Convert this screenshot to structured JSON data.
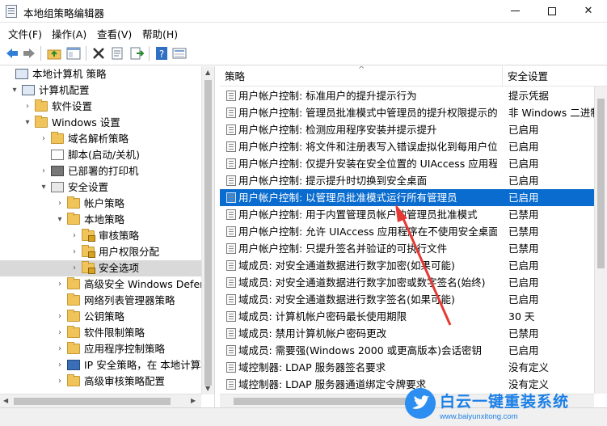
{
  "window": {
    "title": "本地组策略编辑器"
  },
  "menu": [
    {
      "label": "文件(F)"
    },
    {
      "label": "操作(A)"
    },
    {
      "label": "查看(V)"
    },
    {
      "label": "帮助(H)"
    }
  ],
  "toolbar_icons": [
    "back-arrow-icon",
    "forward-arrow-icon",
    "folder-up-icon",
    "show-tree-icon",
    "delete-icon",
    "properties-icon",
    "export-icon",
    "help-icon",
    "console-view-icon"
  ],
  "tree": [
    {
      "label": "本地计算机 策略",
      "level": 0,
      "toggle": "",
      "icon": "computer-icon"
    },
    {
      "label": "计算机配置",
      "level": 1,
      "toggle": "▾",
      "icon": "computer-icon"
    },
    {
      "label": "软件设置",
      "level": 2,
      "toggle": "›",
      "icon": "folder-icon"
    },
    {
      "label": "Windows 设置",
      "level": 2,
      "toggle": "▾",
      "icon": "folder-icon"
    },
    {
      "label": "域名解析策略",
      "level": 3,
      "toggle": "›",
      "icon": "folder-icon"
    },
    {
      "label": "脚本(启动/关机)",
      "level": 3,
      "toggle": "",
      "icon": "script-icon"
    },
    {
      "label": "已部署的打印机",
      "level": 3,
      "toggle": "›",
      "icon": "printer-icon"
    },
    {
      "label": "安全设置",
      "level": 3,
      "toggle": "▾",
      "icon": "security-icon"
    },
    {
      "label": "帐户策略",
      "level": 4,
      "toggle": "›",
      "icon": "folder-icon"
    },
    {
      "label": "本地策略",
      "level": 4,
      "toggle": "▾",
      "icon": "folder-icon"
    },
    {
      "label": "审核策略",
      "level": 5,
      "toggle": "›",
      "icon": "lock-folder-icon"
    },
    {
      "label": "用户权限分配",
      "level": 5,
      "toggle": "›",
      "icon": "lock-folder-icon"
    },
    {
      "label": "安全选项",
      "level": 5,
      "toggle": "›",
      "icon": "lock-folder-icon",
      "selected": true
    },
    {
      "label": "高级安全 Windows Defende",
      "level": 4,
      "toggle": "›",
      "icon": "folder-icon"
    },
    {
      "label": "网络列表管理器策略",
      "level": 4,
      "toggle": "",
      "icon": "folder-icon"
    },
    {
      "label": "公钥策略",
      "level": 4,
      "toggle": "›",
      "icon": "folder-icon"
    },
    {
      "label": "软件限制策略",
      "level": 4,
      "toggle": "›",
      "icon": "folder-icon"
    },
    {
      "label": "应用程序控制策略",
      "level": 4,
      "toggle": "›",
      "icon": "folder-icon"
    },
    {
      "label": "IP 安全策略，在 本地计算机",
      "level": 4,
      "toggle": "›",
      "icon": "ip-security-icon"
    },
    {
      "label": "高级审核策略配置",
      "level": 4,
      "toggle": "›",
      "icon": "folder-icon"
    }
  ],
  "columns": {
    "policy": "策略",
    "setting": "安全设置"
  },
  "rows": [
    {
      "policy": "用户帐户控制: 标准用户的提升提示行为",
      "setting": "提示凭据"
    },
    {
      "policy": "用户帐户控制: 管理员批准模式中管理员的提升权限提示的...",
      "setting": "非 Windows 二进制"
    },
    {
      "policy": "用户帐户控制: 检测应用程序安装并提示提升",
      "setting": "已启用"
    },
    {
      "policy": "用户帐户控制: 将文件和注册表写入错误虚拟化到每用户位置",
      "setting": "已启用"
    },
    {
      "policy": "用户帐户控制: 仅提升安装在安全位置的 UIAccess 应用程序",
      "setting": "已启用"
    },
    {
      "policy": "用户帐户控制: 提示提升时切换到安全桌面",
      "setting": "已启用"
    },
    {
      "policy": "用户帐户控制: 以管理员批准模式运行所有管理员",
      "setting": "已启用",
      "selected": true
    },
    {
      "policy": "用户帐户控制: 用于内置管理员帐户的管理员批准模式",
      "setting": "已禁用"
    },
    {
      "policy": "用户帐户控制: 允许 UIAccess 应用程序在不使用安全桌面...",
      "setting": "已禁用"
    },
    {
      "policy": "用户帐户控制: 只提升签名并验证的可执行文件",
      "setting": "已禁用"
    },
    {
      "policy": "域成员: 对安全通道数据进行数字加密(如果可能)",
      "setting": "已启用"
    },
    {
      "policy": "域成员: 对安全通道数据进行数字加密或数字签名(始终)",
      "setting": "已启用"
    },
    {
      "policy": "域成员: 对安全通道数据进行数字签名(如果可能)",
      "setting": "已启用"
    },
    {
      "policy": "域成员: 计算机帐户密码最长使用期限",
      "setting": "30 天"
    },
    {
      "policy": "域成员: 禁用计算机帐户密码更改",
      "setting": "已禁用"
    },
    {
      "policy": "域成员: 需要强(Windows 2000 或更高版本)会话密钥",
      "setting": "已启用"
    },
    {
      "policy": "域控制器: LDAP 服务器签名要求",
      "setting": "没有定义"
    },
    {
      "policy": "域控制器: LDAP 服务器通道绑定令牌要求",
      "setting": "没有定义"
    }
  ],
  "watermark": {
    "title": "白云一键重装系统",
    "url": "www.baiyunxitong.com"
  },
  "colors": {
    "selection": "#0a6ccf",
    "annotation_arrow": "#e53935"
  }
}
